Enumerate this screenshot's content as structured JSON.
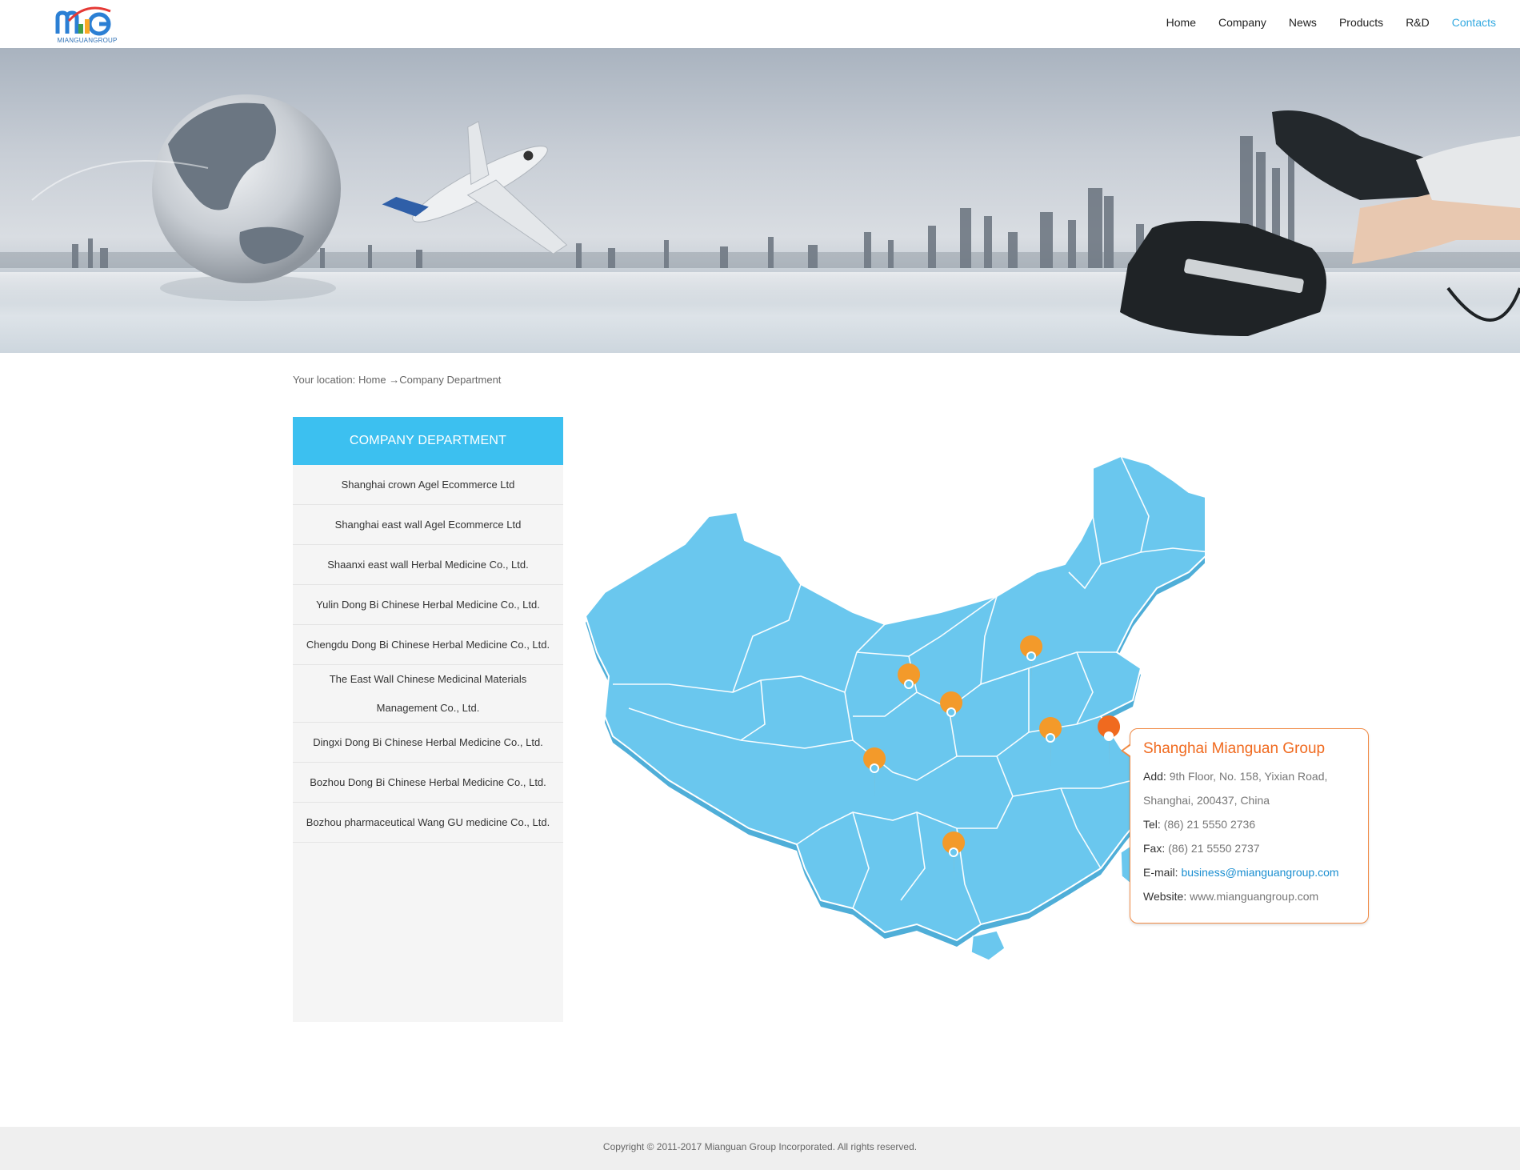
{
  "brand": {
    "logo_text": "MIANGUANGROUP"
  },
  "nav": {
    "items": [
      {
        "label": "Home",
        "active": false
      },
      {
        "label": "Company",
        "active": false
      },
      {
        "label": "News",
        "active": false
      },
      {
        "label": "Products",
        "active": false
      },
      {
        "label": "R&D",
        "active": false
      },
      {
        "label": "Contacts",
        "active": true
      }
    ]
  },
  "breadcrumb": {
    "prefix": "Your location:",
    "home": "Home",
    "arrow": "→",
    "current": "Company Department"
  },
  "sidebar": {
    "title": "COMPANY DEPARTMENT",
    "items": [
      "Shanghai crown Agel Ecommerce Ltd",
      "Shanghai east wall Agel Ecommerce Ltd",
      "Shaanxi east wall Herbal Medicine Co., Ltd.",
      "Yulin Dong Bi Chinese Herbal Medicine Co., Ltd.",
      "Chengdu Dong Bi Chinese Herbal Medicine Co., Ltd.",
      "The East Wall Chinese Medicinal Materials Management Co., Ltd.",
      "Dingxi Dong Bi Chinese Herbal Medicine Co., Ltd.",
      "Bozhou Dong Bi Chinese Herbal Medicine Co., Ltd.",
      "Bozhou pharmaceutical Wang GU medicine Co., Ltd."
    ]
  },
  "contact": {
    "title": "Shanghai Mianguan Group",
    "add_label": "Add:",
    "add_value": "9th Floor, No. 158, Yixian Road, Shanghai, 200437, China",
    "tel_label": "Tel:",
    "tel_value": "(86) 21 5550 2736",
    "fax_label": "Fax:",
    "fax_value": "(86) 21 5550 2737",
    "email_label": "E-mail:",
    "email_value": "business@mianguangroup.com",
    "web_label": "Website:",
    "web_value": "www.mianguangroup.com"
  },
  "footer": {
    "copyright": "Copyright © 2011-2017 Mianguan Group Incorporated. All rights reserved."
  },
  "colors": {
    "accent": "#3cc0f0",
    "nav_active": "#33a9e0",
    "map": "#6ac7ee",
    "marker": "#f39a2a",
    "marker_active": "#f06a1f"
  }
}
